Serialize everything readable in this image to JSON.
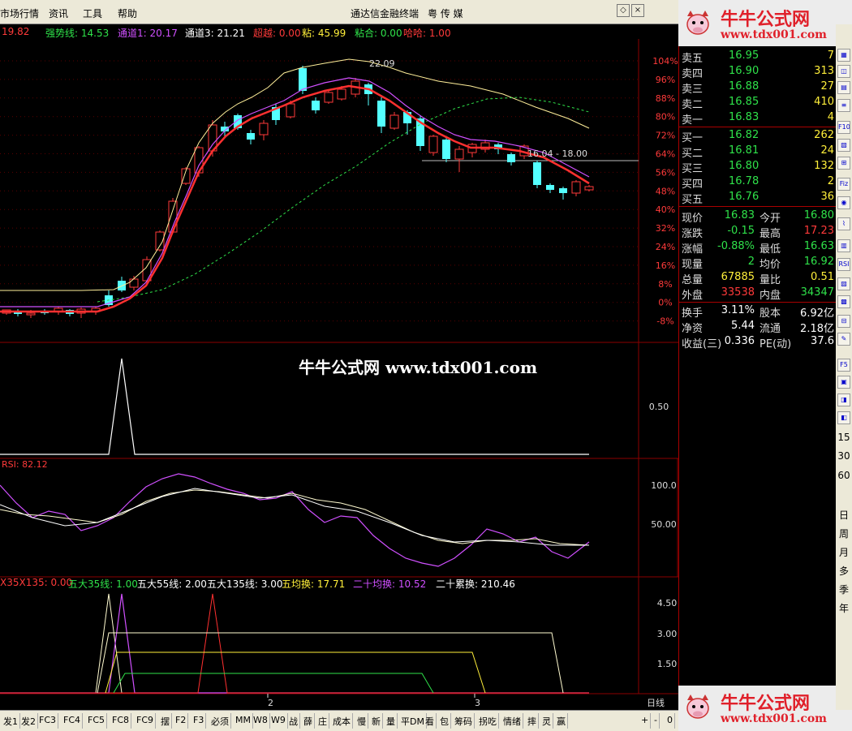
{
  "menubar": {
    "items": [
      "市场行情",
      "资讯",
      "工具",
      "帮助"
    ],
    "title": "通达信金融终端",
    "brand": "粤 传 媒"
  },
  "indicators_main": [
    {
      "text": "19.82",
      "color": "#ff3a3a"
    },
    {
      "text": "强势线: 14.53",
      "color": "#2fe24a"
    },
    {
      "text": "通道1: 20.17",
      "color": "#d050ff"
    },
    {
      "text": "通道3: 21.21",
      "color": "#ffffff"
    },
    {
      "text": "超越: 0.00",
      "color": "#ff3a3a"
    },
    {
      "text": "粘: 45.99",
      "color": "#ffef3a"
    },
    {
      "text": "粘合: 0.00",
      "color": "#2fe24a"
    },
    {
      "text": "哈哈: 1.00",
      "color": "#ff3a3a"
    }
  ],
  "price_axis": [
    "104%",
    "96%",
    "88%",
    "80%",
    "72%",
    "64%",
    "56%",
    "48%",
    "40%",
    "32%",
    "24%",
    "16%",
    "8%",
    "0%",
    "-8%"
  ],
  "chart_annotations": {
    "high_label": "22.09",
    "range_label": "16.04 - 18.00"
  },
  "sub1": {
    "axis_label": "0.50"
  },
  "rsi": {
    "label": "RSI: 82.12",
    "axis": [
      "100.0",
      "50.00"
    ]
  },
  "sub3": {
    "labels": [
      {
        "text": "X35X135: 0.00",
        "color": "#ff3a3a"
      },
      {
        "text": "五大35线: 1.00",
        "color": "#2fe24a"
      },
      {
        "text": "五大55线: 2.00",
        "color": "#ffffff"
      },
      {
        "text": "五大135线: 3.00",
        "color": "#ffffff"
      },
      {
        "text": "五均换: 17.71",
        "color": "#ffef3a"
      },
      {
        "text": "二十均换: 10.52",
        "color": "#d050ff"
      },
      {
        "text": "二十累换: 210.46",
        "color": "#ffffff"
      }
    ],
    "axis": [
      "4.50",
      "3.00",
      "1.50"
    ]
  },
  "x_axis": {
    "ticks": [
      "2",
      "3"
    ],
    "period": "日线"
  },
  "watermark": "牛牛公式网 www.tdx001.com",
  "logo": {
    "title": "牛牛公式网",
    "url": "www.tdx001.com"
  },
  "order_book": {
    "sell": [
      {
        "label": "卖五",
        "price": "16.95",
        "vol": "7"
      },
      {
        "label": "卖四",
        "price": "16.90",
        "vol": "313"
      },
      {
        "label": "卖三",
        "price": "16.88",
        "vol": "27"
      },
      {
        "label": "卖二",
        "price": "16.85",
        "vol": "410"
      },
      {
        "label": "卖一",
        "price": "16.83",
        "vol": "4"
      }
    ],
    "buy": [
      {
        "label": "买一",
        "price": "16.82",
        "vol": "262"
      },
      {
        "label": "买二",
        "price": "16.81",
        "vol": "24"
      },
      {
        "label": "买三",
        "price": "16.80",
        "vol": "132"
      },
      {
        "label": "买四",
        "price": "16.78",
        "vol": "2"
      },
      {
        "label": "买五",
        "price": "16.76",
        "vol": "36"
      }
    ]
  },
  "stats": [
    {
      "l1": "现价",
      "v1": "16.83",
      "c1": "grn",
      "l2": "今开",
      "v2": "16.80",
      "c2": "grn"
    },
    {
      "l1": "涨跌",
      "v1": "-0.15",
      "c1": "grn",
      "l2": "最高",
      "v2": "17.23",
      "c2": "red"
    },
    {
      "l1": "涨幅",
      "v1": "-0.88%",
      "c1": "grn",
      "l2": "最低",
      "v2": "16.63",
      "c2": "grn"
    },
    {
      "l1": "现量",
      "v1": "2",
      "c1": "grn",
      "l2": "均价",
      "v2": "16.92",
      "c2": "grn"
    },
    {
      "l1": "总量",
      "v1": "67885",
      "c1": "yel",
      "l2": "量比",
      "v2": "0.51",
      "c2": "yel"
    },
    {
      "l1": "外盘",
      "v1": "33538",
      "c1": "red",
      "l2": "内盘",
      "v2": "34347",
      "c2": "grn"
    }
  ],
  "stats2": [
    {
      "l1": "换手",
      "v1": "3.11%",
      "l2": "股本",
      "v2": "6.92亿"
    },
    {
      "l1": "净资",
      "v1": "5.44",
      "l2": "流通",
      "v2": "2.18亿"
    },
    {
      "l1": "收益(三)",
      "v1": "0.336",
      "l2": "PE(动)",
      "v2": "37.6"
    }
  ],
  "side_labels": [
    "F5",
    "15",
    "30",
    "60",
    "日",
    "周",
    "月",
    "多",
    "季",
    "年"
  ],
  "side_icons": [
    "F10",
    "Fiz",
    "RSI"
  ],
  "tabs": [
    "发1",
    "发2",
    "FC3",
    "FC4",
    "FC5",
    "FC8",
    "FC9",
    "摆",
    "F2",
    "F3",
    "必须",
    "MM",
    "W8",
    "W9",
    "战",
    "薛",
    "庄",
    "成本",
    "慢",
    "新",
    "量",
    "平DM",
    "看",
    "包",
    "筹码",
    "拐吃",
    "情绪",
    "摔",
    "灵",
    "赢"
  ],
  "tab_controls": [
    "+",
    "-",
    "0"
  ],
  "colors": {
    "up": "#ff3a3a",
    "down": "#54ffff",
    "grid": "#8b0000"
  }
}
